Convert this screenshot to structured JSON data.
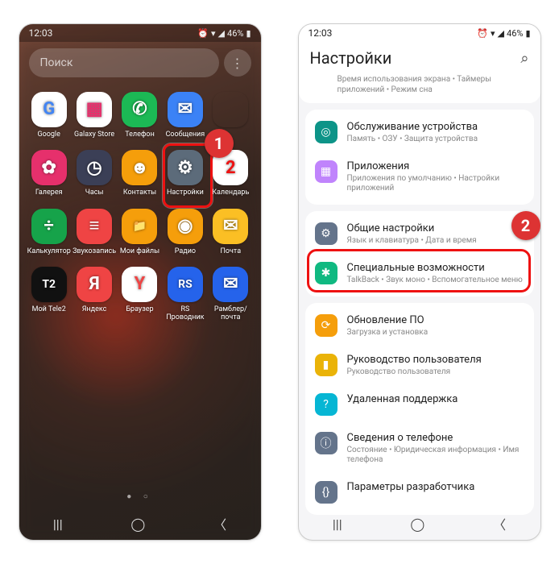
{
  "left": {
    "status": {
      "time": "12:03",
      "battery": "46%"
    },
    "search_placeholder": "Поиск",
    "apps": [
      {
        "label": "Google",
        "color": "#fff",
        "glyph": "G",
        "txt": "#4285f4"
      },
      {
        "label": "Galaxy Store",
        "color": "#fff",
        "glyph": "▦",
        "txt": "#e6306c"
      },
      {
        "label": "Телефон",
        "color": "#1cb955",
        "glyph": "✆"
      },
      {
        "label": "Сообщения",
        "color": "#3b82f6",
        "glyph": "✉"
      },
      {
        "label": "",
        "color": "transparent",
        "glyph": ""
      },
      {
        "label": "Галерея",
        "color": "#e6306c",
        "glyph": "✿"
      },
      {
        "label": "Часы",
        "color": "#3b3f56",
        "glyph": "◷"
      },
      {
        "label": "Контакты",
        "color": "#f59e0b",
        "glyph": "☻"
      },
      {
        "label": "Настройки",
        "color": "#5c6b7a",
        "glyph": "⚙"
      },
      {
        "label": "Календарь",
        "color": "#fff",
        "glyph": "2",
        "txt": "#e11"
      },
      {
        "label": "Калькулятор",
        "color": "#16a34a",
        "glyph": "÷"
      },
      {
        "label": "Звукозапись",
        "color": "#ef4444",
        "glyph": "≡"
      },
      {
        "label": "Мои файлы",
        "color": "#f59e0b",
        "glyph": "📁"
      },
      {
        "label": "Радио",
        "color": "#f59e0b",
        "glyph": "◉"
      },
      {
        "label": "Почта",
        "color": "#fbbf24",
        "glyph": "✉"
      },
      {
        "label": "Мой Tele2",
        "color": "#111",
        "glyph": "T2",
        "txt": "#fff"
      },
      {
        "label": "Яндекс",
        "color": "#ef4444",
        "glyph": "Я"
      },
      {
        "label": "Браузер",
        "color": "#fff",
        "glyph": "Y",
        "txt": "#ef4444"
      },
      {
        "label": "RS Проводник",
        "color": "#2563eb",
        "glyph": "RS"
      },
      {
        "label": "Рамблер/почта",
        "color": "#2563eb",
        "glyph": "✉"
      }
    ],
    "badge": "1"
  },
  "right": {
    "status": {
      "time": "12:03",
      "battery": "46%"
    },
    "title": "Настройки",
    "overflow_sub": "Время использования экрана • Таймеры приложений • Режим сна",
    "groups": [
      {
        "items": [
          {
            "title": "Обслуживание устройства",
            "sub": "Память • ОЗУ • Защита устройства",
            "color": "#0d9488",
            "glyph": "◎"
          },
          {
            "title": "Приложения",
            "sub": "Приложения по умолчанию • Настройки приложений",
            "color": "#c084fc",
            "glyph": "▦"
          }
        ]
      },
      {
        "items": [
          {
            "title": "Общие настройки",
            "sub": "Язык и клавиатура • Дата и время",
            "color": "#64748b",
            "glyph": "⚙"
          },
          {
            "title": "Специальные возможности",
            "sub": "TalkBack • Звук моно • Вспомогательное меню",
            "color": "#10b981",
            "glyph": "✱"
          }
        ]
      },
      {
        "items": [
          {
            "title": "Обновление ПО",
            "sub": "Загрузка и установка",
            "color": "#f59e0b",
            "glyph": "⟳"
          },
          {
            "title": "Руководство пользователя",
            "sub": "Руководство пользователя",
            "color": "#eab308",
            "glyph": "▮"
          },
          {
            "title": "Удаленная поддержка",
            "sub": "",
            "color": "#06b6d4",
            "glyph": "?"
          },
          {
            "title": "Сведения о телефоне",
            "sub": "Состояние • Юридическая информация • Имя телефона",
            "color": "#64748b",
            "glyph": "ⓘ"
          },
          {
            "title": "Параметры разработчика",
            "sub": "",
            "color": "#64748b",
            "glyph": "{}"
          }
        ]
      }
    ],
    "badge": "2"
  }
}
